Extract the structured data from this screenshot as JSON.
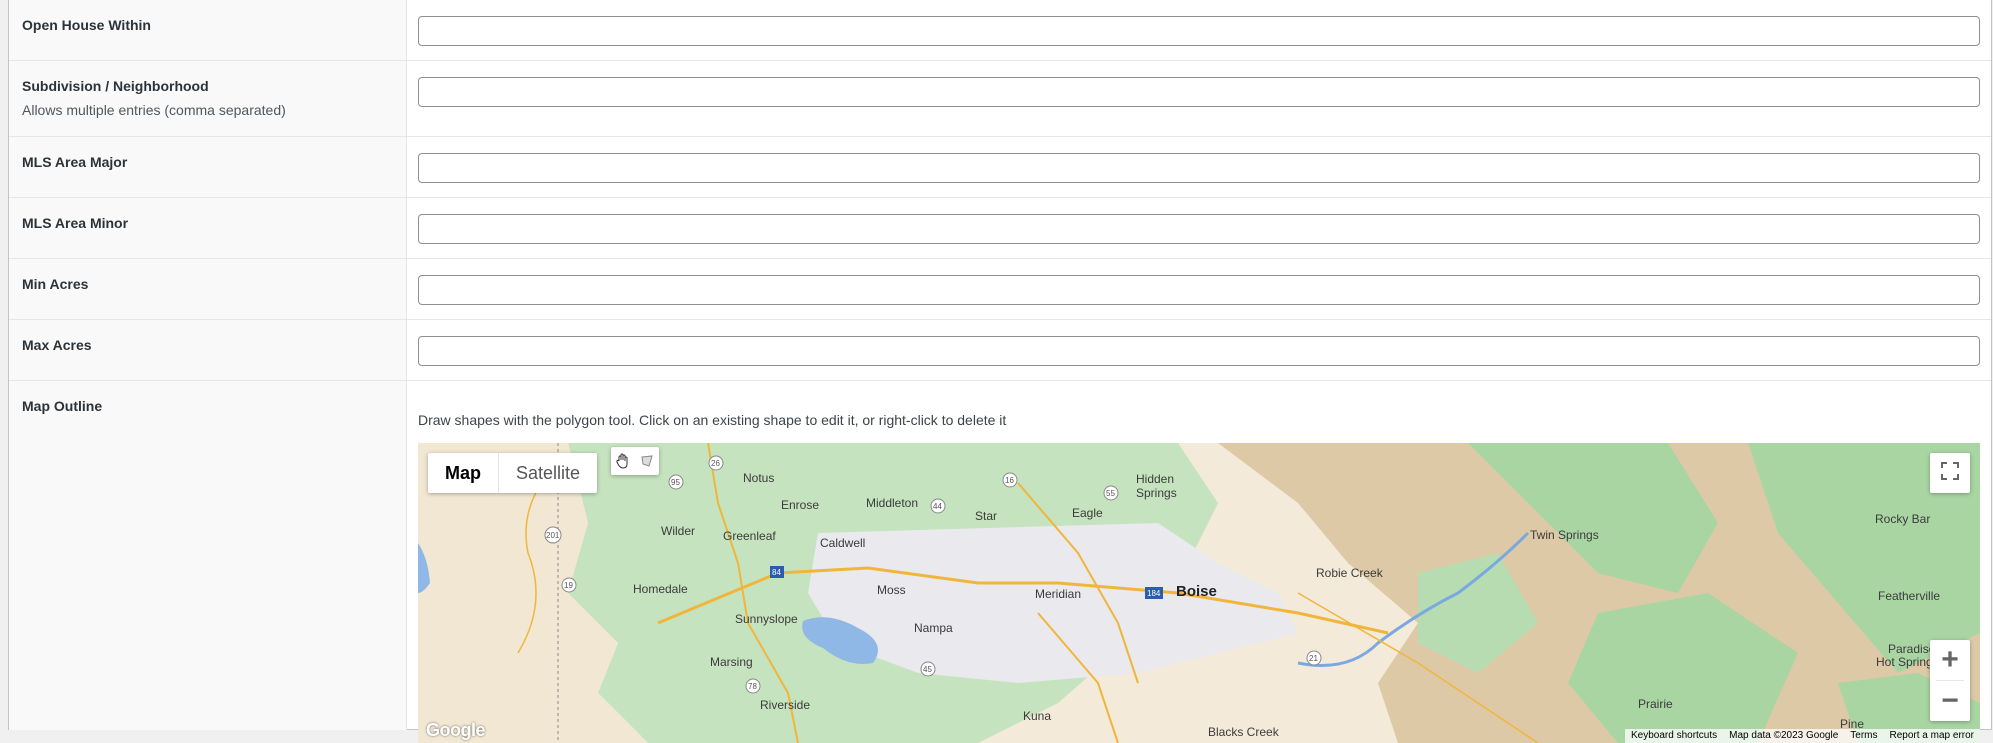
{
  "fields": [
    {
      "label": "Open House Within",
      "description": "",
      "value": ""
    },
    {
      "label": "Subdivision / Neighborhood",
      "description": "Allows multiple entries (comma separated)",
      "value": ""
    },
    {
      "label": "MLS Area Major",
      "description": "",
      "value": ""
    },
    {
      "label": "MLS Area Minor",
      "description": "",
      "value": ""
    },
    {
      "label": "Min Acres",
      "description": "",
      "value": ""
    },
    {
      "label": "Max Acres",
      "description": "",
      "value": ""
    }
  ],
  "map_outline": {
    "label": "Map Outline",
    "help": "Draw shapes with the polygon tool. Click on an existing shape to edit it, or right-click to delete it"
  },
  "map": {
    "type_controls": {
      "map": "Map",
      "satellite": "Satellite",
      "selected": "Map"
    },
    "draw_tools": [
      "hand-icon",
      "polygon-icon"
    ],
    "zoom_in": "+",
    "zoom_out": "−",
    "logo": "Google",
    "attribution": {
      "shortcuts": "Keyboard shortcuts",
      "data": "Map data ©2023 Google",
      "terms": "Terms",
      "report": "Report a map error"
    },
    "places": {
      "notus": "Notus",
      "enrose": "Enrose",
      "middleton": "Middleton",
      "star": "Star",
      "eagle": "Eagle",
      "hidden_springs": "Hidden",
      "hidden_springs2": "Springs",
      "rocky_bar": "Rocky Bar",
      "wilder": "Wilder",
      "greenleaf": "Greenleaf",
      "caldwell": "Caldwell",
      "twin_springs": "Twin Springs",
      "homedale": "Homedale",
      "moss": "Moss",
      "meridian": "Meridian",
      "boise": "Boise",
      "robie_creek": "Robie Creek",
      "featherville": "Featherville",
      "sunnyslope": "Sunnyslope",
      "nampa": "Nampa",
      "marsing": "Marsing",
      "riverside": "Riverside",
      "paradise": "Paradise",
      "hot_springs": "Hot Springs",
      "prairie": "Prairie",
      "kuna": "Kuna",
      "blacks_creek": "Blacks Creek",
      "pine": "Pine"
    },
    "shields": {
      "s26": "26",
      "s95": "95",
      "s16": "16",
      "s55": "55",
      "s44": "44",
      "s201": "201",
      "s19": "19",
      "s84a": "84",
      "s184": "184",
      "s21": "21",
      "s45": "45",
      "s78": "78"
    },
    "colors": {
      "land": "#f3ead9",
      "green": "#b9ddb5",
      "mountain": "#d9c6a5",
      "water": "#8fb8e6",
      "urban": "#e8e8ec",
      "highway": "#f5c04a"
    }
  }
}
